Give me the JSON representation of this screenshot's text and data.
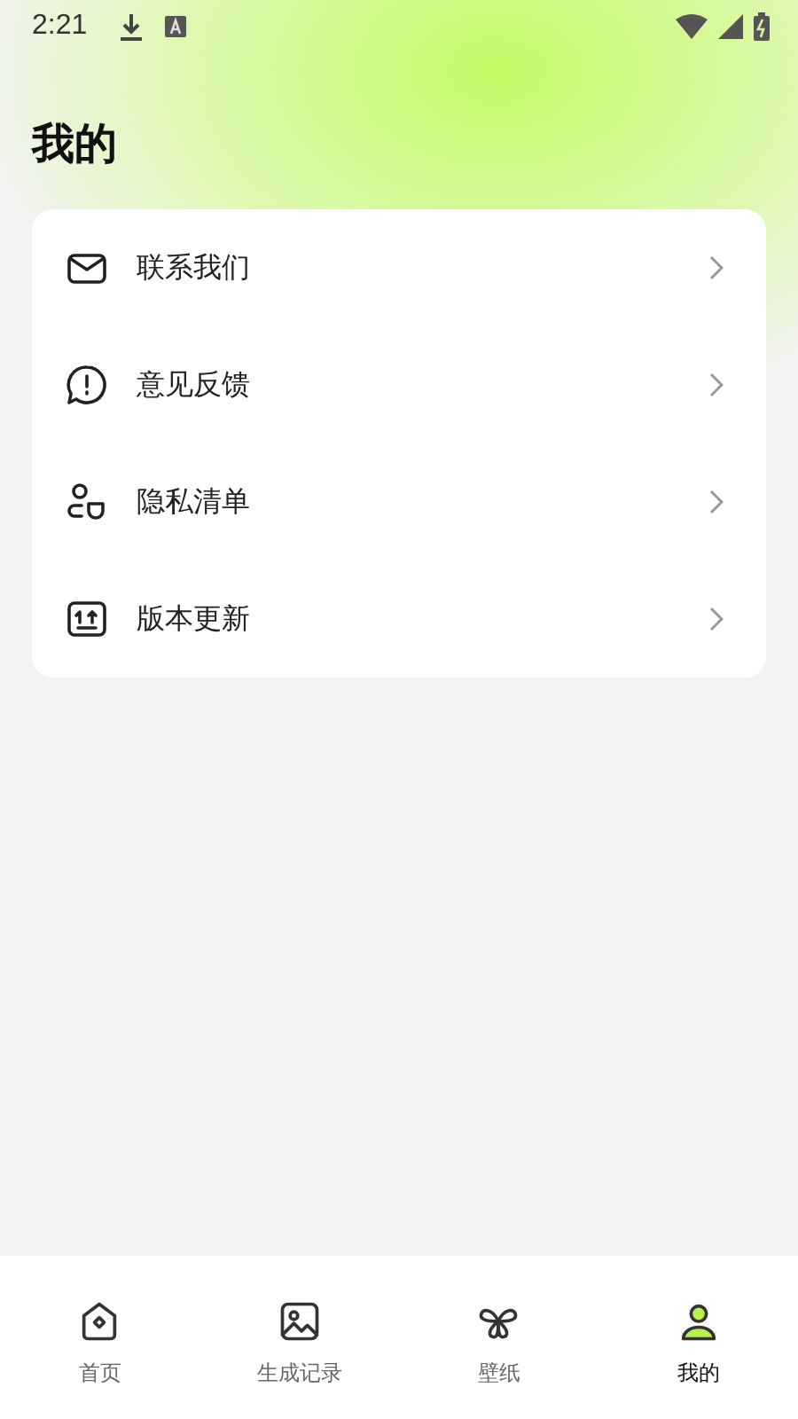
{
  "status_bar": {
    "time": "2:21"
  },
  "title": "我的",
  "menu": [
    {
      "kind": "mail",
      "label": "联系我们"
    },
    {
      "kind": "feedback",
      "label": "意见反馈"
    },
    {
      "kind": "privacy",
      "label": "隐私清单"
    },
    {
      "kind": "update",
      "label": "版本更新"
    }
  ],
  "nav": [
    {
      "kind": "home",
      "label": "首页",
      "selected": false
    },
    {
      "kind": "gallery",
      "label": "生成记录",
      "selected": false
    },
    {
      "kind": "wallpaper",
      "label": "壁纸",
      "selected": false
    },
    {
      "kind": "profile",
      "label": "我的",
      "selected": true
    }
  ]
}
